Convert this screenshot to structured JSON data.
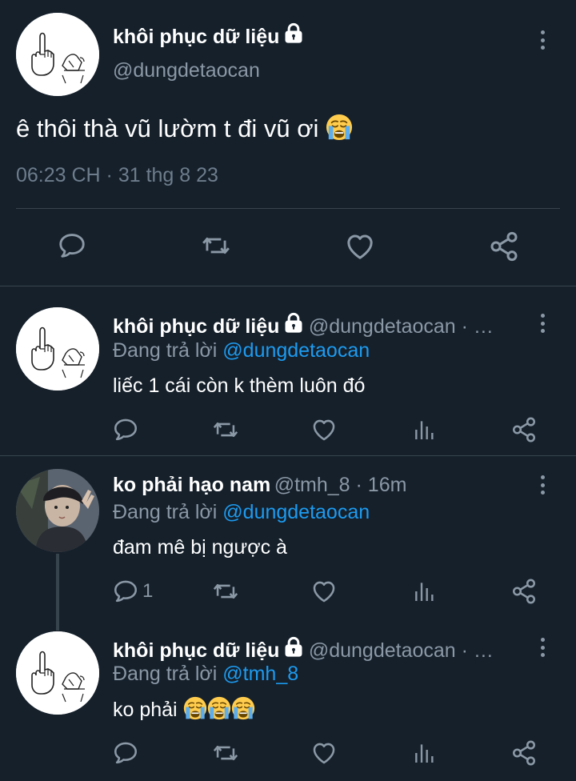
{
  "main_tweet": {
    "display_name": "khôi phục dữ liệu",
    "handle": "@dungdetaocan",
    "text": "ê thôi thà vũ lườm t đi vũ ơi",
    "timestamp": "06:23 CH · 31 thg 8 23"
  },
  "replies": [
    {
      "display_name": "khôi phục dữ liệu",
      "handle": "@dungdetaocan · …",
      "replying_prefix": "Đang trả lời ",
      "replying_to": "@dungdetaocan",
      "text": "liếc 1 cái còn k thèm luôn đó",
      "reply_count": ""
    },
    {
      "display_name": "ko phải hạo nam",
      "handle": "@tmh_8 · 16m",
      "replying_prefix": "Đang trả lời ",
      "replying_to": "@dungdetaocan",
      "text": "đam mê bị ngược à",
      "reply_count": "1"
    },
    {
      "display_name": "khôi phục dữ liệu",
      "handle": "@dungdetaocan · …",
      "replying_prefix": "Đang trả lời ",
      "replying_to": "@tmh_8",
      "text": "ko phải",
      "reply_count": ""
    }
  ],
  "icons": {
    "reply": "reply-icon",
    "retweet": "retweet-icon",
    "like": "heart-icon",
    "share": "share-icon",
    "analytics": "analytics-icon",
    "more": "more-vertical-icon",
    "lock": "lock-icon",
    "emoji": "loudly-crying-face-emoji"
  },
  "colors": {
    "background": "#15202b",
    "text_secondary": "#8b98a5",
    "link": "#1d9bf0",
    "divider": "#38444d"
  }
}
